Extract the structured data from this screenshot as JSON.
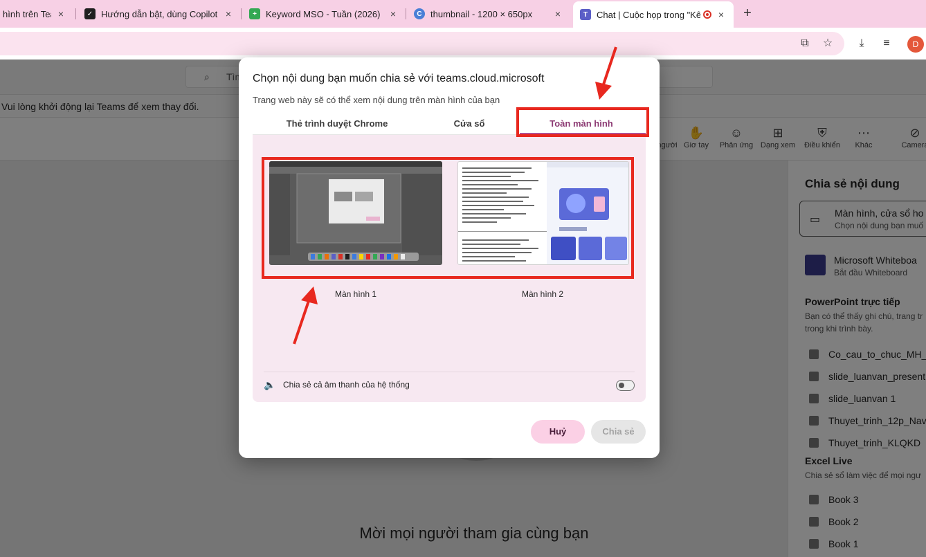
{
  "browser": {
    "tabs": [
      {
        "title": "hình trên Tea",
        "fav_color": "#f7d0e5"
      },
      {
        "title": "Hướng dẫn bật, dùng Copilot",
        "fav_color": "#1f1f1f"
      },
      {
        "title": "Keyword MSO - Tuần (2026)",
        "fav_color": "#34a853"
      },
      {
        "title": "thumbnail - 1200 × 650px",
        "fav_color": "#4a7fd6"
      },
      {
        "title": "Chat | Cuộc họp trong \"Kê",
        "fav_color": "#5b5fc7"
      }
    ],
    "new_tab": "+",
    "close_glyph": "×",
    "profile_initial": "D"
  },
  "teams": {
    "search_placeholder": "Tìm",
    "banner_text": "Vui lòng khởi động lại Teams để xem thay đổi.",
    "meeting_bar": [
      {
        "label": "người",
        "icon": "people-icon",
        "glyph": ""
      },
      {
        "label": "Giơ tay",
        "icon": "raise-hand-icon",
        "glyph": "✋"
      },
      {
        "label": "Phản ứng",
        "icon": "reaction-icon",
        "glyph": "☺"
      },
      {
        "label": "Dạng xem",
        "icon": "view-grid-icon",
        "glyph": "⊞"
      },
      {
        "label": "Điều khiển",
        "icon": "shield-gear-icon",
        "glyph": "⛨"
      },
      {
        "label": "Khác",
        "icon": "more-icon",
        "glyph": "⋯"
      },
      {
        "label": "Camera",
        "icon": "camera-off-icon",
        "glyph": "⊘"
      }
    ],
    "invite_text": "Mời mọi người tham gia cùng bạn",
    "share_panel": {
      "title": "Chia sẻ nội dung",
      "screen_card": {
        "title": "Màn hình, cửa sổ ho",
        "subtitle": "Chọn nội dung bạn muố"
      },
      "whiteboard": {
        "title": "Microsoft Whiteboa",
        "subtitle": "Bắt đầu Whiteboard"
      },
      "powerpoint": {
        "title": "PowerPoint trực tiếp",
        "subtitle": "Bạn có thể thấy ghi chú, trang tr trong khi trình bày.",
        "files": [
          "Co_cau_to_chuc_MH_",
          "slide_luanvan_present",
          "slide_luanvan 1",
          "Thuyet_trinh_12p_Nav",
          "Thuyet_trinh_KLQKD"
        ]
      },
      "excel": {
        "title": "Excel Live",
        "subtitle": "Chia sẻ sổ làm việc để mọi ngư",
        "files": [
          "Book 3",
          "Book 2",
          "Book 1"
        ]
      }
    }
  },
  "dialog": {
    "title": "Chọn nội dung bạn muốn chia sẻ với teams.cloud.microsoft",
    "subtitle": "Trang web này sẽ có thể xem nội dung trên màn hình của bạn",
    "tabs": [
      "Thẻ trình duyệt Chrome",
      "Cửa sổ",
      "Toàn màn hình"
    ],
    "active_tab": 2,
    "screens": [
      "Màn hình 1",
      "Màn hình 2"
    ],
    "audio_label": "Chia sẻ cả âm thanh của hệ thống",
    "audio_enabled": false,
    "cancel_label": "Huỷ",
    "share_label": "Chia sẻ"
  },
  "colors": {
    "accent": "#b24f8f",
    "annotation": "#e8281f"
  }
}
